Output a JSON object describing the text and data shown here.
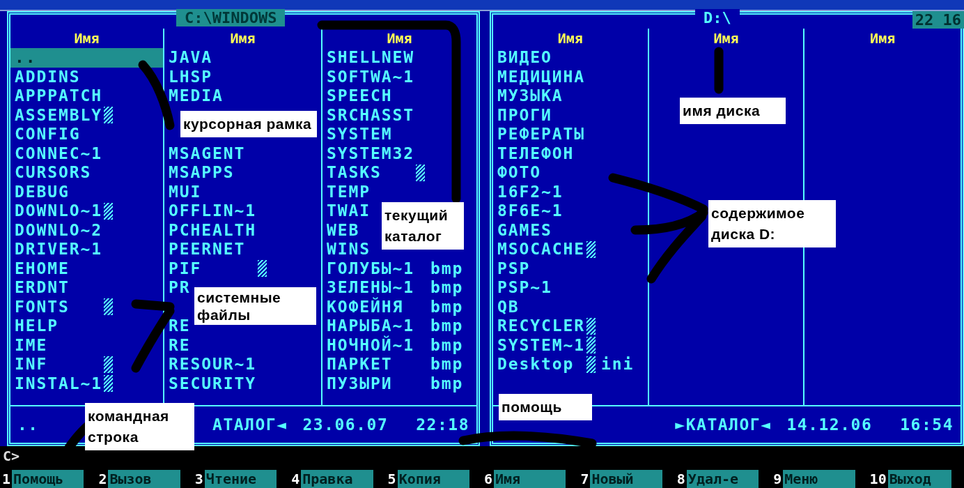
{
  "left_panel": {
    "path": "C:\\WINDOWS",
    "active": true,
    "columns": [
      {
        "header": "Имя",
        "files": [
          {
            "name": "..",
            "selected": true,
            "system": false
          },
          {
            "name": "ADDINS",
            "selected": false,
            "system": false
          },
          {
            "name": "APPPATCH",
            "selected": false,
            "system": false
          },
          {
            "name": "ASSEMBLY",
            "selected": false,
            "system": true
          },
          {
            "name": "CONFIG",
            "selected": false,
            "system": false
          },
          {
            "name": "CONNEC~1",
            "selected": false,
            "system": false
          },
          {
            "name": "CURSORS",
            "selected": false,
            "system": false
          },
          {
            "name": "DEBUG",
            "selected": false,
            "system": false
          },
          {
            "name": "DOWNLO~1",
            "selected": false,
            "system": true
          },
          {
            "name": "DOWNLO~2",
            "selected": false,
            "system": false
          },
          {
            "name": "DRIVER~1",
            "selected": false,
            "system": false
          },
          {
            "name": "EHOME",
            "selected": false,
            "system": false
          },
          {
            "name": "ERDNT",
            "selected": false,
            "system": false
          },
          {
            "name": "FONTS",
            "selected": false,
            "system": true
          },
          {
            "name": "HELP",
            "selected": false,
            "system": false
          },
          {
            "name": "IME",
            "selected": false,
            "system": false
          },
          {
            "name": "INF",
            "selected": false,
            "system": true
          },
          {
            "name": "INSTAL~1",
            "selected": false,
            "system": true
          }
        ]
      },
      {
        "header": "Имя",
        "files": [
          {
            "kind": "file",
            "name": "JAVA",
            "selected": false,
            "system": false
          },
          {
            "kind": "file",
            "name": "LHSP",
            "selected": false,
            "system": false
          },
          {
            "kind": "file",
            "name": "MEDIA",
            "selected": false,
            "system": false
          },
          {
            "kind": "callout",
            "text": "курсорная рамка"
          },
          {
            "kind": "file",
            "name": "MSAGENT",
            "selected": false,
            "system": false
          },
          {
            "kind": "file",
            "name": "MSAPPS",
            "selected": false,
            "system": false
          },
          {
            "kind": "file",
            "name": "MUI",
            "selected": false,
            "system": false
          },
          {
            "kind": "file",
            "name": "OFFLIN~1",
            "selected": false,
            "system": false
          },
          {
            "kind": "file",
            "name": "PCHEALTH",
            "selected": false,
            "system": false
          },
          {
            "kind": "file",
            "name": "PEERNET",
            "selected": false,
            "system": false
          },
          {
            "kind": "file",
            "name": "PIF",
            "selected": false,
            "system": true
          },
          {
            "kind": "file",
            "name": "PR",
            "selected": false,
            "system": false
          },
          {
            "kind": "side_callout",
            "text": "системные файлы"
          },
          {
            "kind": "file",
            "name": "RE",
            "selected": false,
            "system": false
          },
          {
            "kind": "file",
            "name": "RE",
            "selected": false,
            "system": false
          },
          {
            "kind": "file",
            "name": "RESOUR~1",
            "selected": false,
            "system": false
          },
          {
            "kind": "file",
            "name": "SECURITY",
            "selected": false,
            "system": false
          }
        ]
      },
      {
        "header": "Имя",
        "files": [
          {
            "name": "SHELLNEW",
            "selected": false,
            "system": false
          },
          {
            "name": "SOFTWA~1",
            "selected": false,
            "system": false
          },
          {
            "name": "SPEECH",
            "selected": false,
            "system": false
          },
          {
            "name": "SRCHASST",
            "selected": false,
            "system": false
          },
          {
            "name": "SYSTEM",
            "selected": false,
            "system": false
          },
          {
            "name": "SYSTEM32",
            "selected": false,
            "system": false
          },
          {
            "name": "TASKS",
            "selected": false,
            "system": true
          },
          {
            "name": "TEMP",
            "selected": false,
            "system": false
          },
          {
            "name": "TWAI",
            "selected": false,
            "system": false
          },
          {
            "name": "WEB",
            "selected": false,
            "system": false
          },
          {
            "name": "WINS",
            "selected": false,
            "system": false
          },
          {
            "name": "ГОЛУБЫ~1",
            "ext": "bmp",
            "selected": false,
            "system": false
          },
          {
            "name": "ЗЕЛЕНЫ~1",
            "ext": "bmp",
            "selected": false,
            "system": false
          },
          {
            "name": "КОФЕЙНЯ",
            "ext": "bmp",
            "selected": false,
            "system": false
          },
          {
            "name": "НАРЫБА~1",
            "ext": "bmp",
            "selected": false,
            "system": false
          },
          {
            "name": "НОЧНОЙ~1",
            "ext": "bmp",
            "selected": false,
            "system": false
          },
          {
            "name": "ПАРКЕТ",
            "ext": "bmp",
            "selected": false,
            "system": false
          },
          {
            "name": "ПУЗЫРИ",
            "ext": "bmp",
            "selected": false,
            "system": false
          }
        ]
      }
    ],
    "status": {
      "name": "..",
      "type": "АТАЛОГ◄",
      "date": "23.06.07",
      "time": "22:18"
    }
  },
  "right_panel": {
    "path": "D:\\",
    "active": false,
    "clock": "22 16",
    "columns": [
      {
        "header": "Имя",
        "files": [
          {
            "name": "ВИДЕО",
            "selected": false,
            "system": false
          },
          {
            "name": "МЕДИЦИНА",
            "selected": false,
            "system": false
          },
          {
            "name": "МУЗЫКА",
            "selected": false,
            "system": false
          },
          {
            "name": "ПРОГИ",
            "selected": false,
            "system": false
          },
          {
            "name": "РЕФЕРАТЫ",
            "selected": false,
            "system": false
          },
          {
            "name": "ТЕЛЕФОН",
            "selected": false,
            "system": false
          },
          {
            "name": "ФОТО",
            "selected": false,
            "system": false
          },
          {
            "name": "16F2~1",
            "selected": false,
            "system": false
          },
          {
            "name": "8F6E~1",
            "selected": false,
            "system": false
          },
          {
            "name": "GAMES",
            "selected": false,
            "system": false
          },
          {
            "name": "MSOCACHE",
            "selected": false,
            "system": true
          },
          {
            "name": "PSP",
            "selected": false,
            "system": false
          },
          {
            "name": "PSP~1",
            "selected": false,
            "system": false
          },
          {
            "name": "QB",
            "selected": false,
            "system": false
          },
          {
            "name": "RECYCLER",
            "selected": false,
            "system": true
          },
          {
            "name": "SYSTEM~1",
            "selected": false,
            "system": true
          },
          {
            "name": "Desktop",
            "ext": "ini",
            "selected": false,
            "system": true
          }
        ]
      },
      {
        "header": "Имя"
      },
      {
        "header": "Имя"
      }
    ],
    "status": {
      "type": "►КАТАЛОГ◄",
      "date": "14.12.06",
      "time": "16:54"
    }
  },
  "command_line": {
    "prompt": "C>"
  },
  "function_keys": [
    {
      "number": "1",
      "label": "Помощь"
    },
    {
      "number": "2",
      "label": "Вызов"
    },
    {
      "number": "3",
      "label": "Чтение"
    },
    {
      "number": "4",
      "label": "Правка"
    },
    {
      "number": "5",
      "label": "Копия"
    },
    {
      "number": "6",
      "label": "Имя"
    },
    {
      "number": "7",
      "label": "Новый"
    },
    {
      "number": "8",
      "label": "Удал-е"
    },
    {
      "number": "9",
      "label": "Меню"
    },
    {
      "number": "10",
      "label": "Выход"
    }
  ],
  "callouts": [
    {
      "text": "текущий каталог"
    },
    {
      "text": "имя диска"
    },
    {
      "text": "содержимое диска D:"
    },
    {
      "text": "командная строка"
    },
    {
      "text": "помощь"
    }
  ]
}
